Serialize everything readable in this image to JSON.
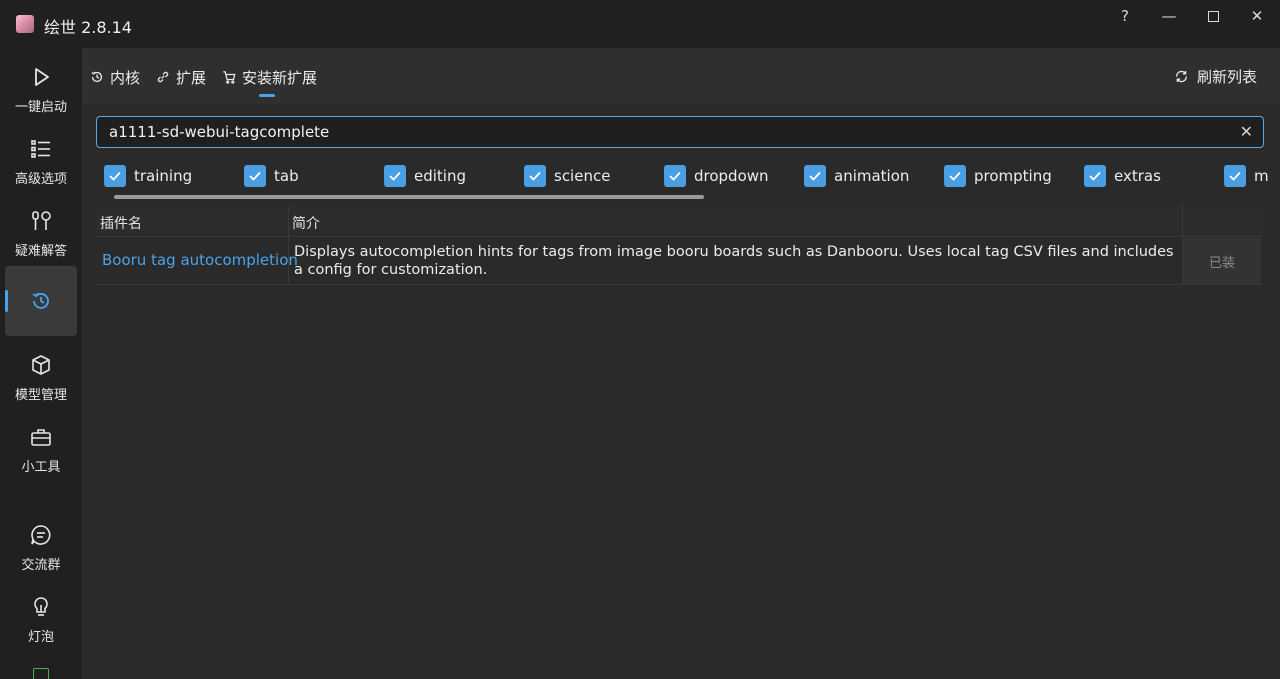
{
  "window": {
    "title": "绘世 2.8.14",
    "help": "?",
    "minimize": "—",
    "close": "✕"
  },
  "sidebar": {
    "items": [
      {
        "label": "一键启动",
        "icon": "play-icon"
      },
      {
        "label": "高级选项",
        "icon": "list-icon"
      },
      {
        "label": "疑难解答",
        "icon": "tools-icon"
      },
      {
        "label": "",
        "icon": "history-icon",
        "active": true
      },
      {
        "label": "模型管理",
        "icon": "cube-icon"
      },
      {
        "label": "小工具",
        "icon": "toolbox-icon"
      },
      {
        "label": "交流群",
        "icon": "chat-icon"
      },
      {
        "label": "灯泡",
        "icon": "bulb-icon"
      }
    ]
  },
  "tabs": [
    {
      "label": "内核",
      "icon": "history-icon"
    },
    {
      "label": "扩展",
      "icon": "link-icon"
    },
    {
      "label": "安装新扩展",
      "icon": "cart-icon",
      "active": true
    }
  ],
  "refresh_label": "刷新列表",
  "search": {
    "value": "a1111-sd-webui-tagcomplete",
    "clear": "✕"
  },
  "tags": [
    "training",
    "tab",
    "editing",
    "science",
    "dropdown",
    "animation",
    "prompting",
    "extras",
    "m"
  ],
  "table": {
    "headers": [
      "插件名",
      "简介"
    ],
    "rows": [
      {
        "name": "Booru tag autocompletion",
        "description": "Displays autocompletion hints for tags from image booru boards such as Danbooru. Uses local tag CSV files and includes a config for customization.",
        "action": "已装"
      }
    ]
  },
  "colors": {
    "accent": "#4aa3ea",
    "background": "#202020",
    "panel": "#2a2a2a"
  }
}
